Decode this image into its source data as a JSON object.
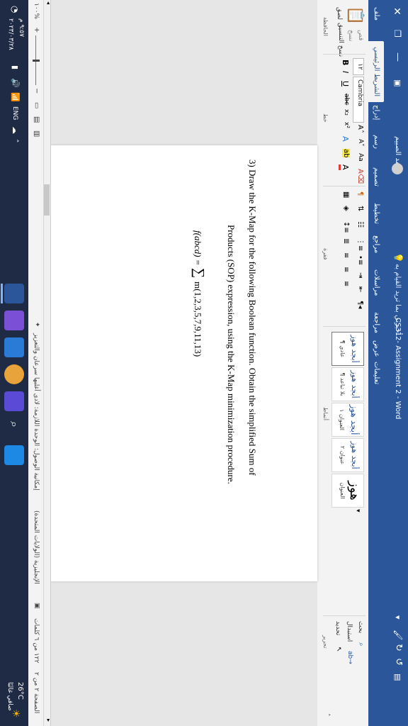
{
  "window": {
    "title": "CS312- Assignment 2  -  Word",
    "user_name": "محمد الصبيم",
    "search_placeholder": "أخبرني بما تريد القيام به"
  },
  "tabs": [
    "ملف",
    "الشريط الرئيسي",
    "إدراج",
    "رسم",
    "تصميم",
    "تخطيط",
    "مراجع",
    "مراسلات",
    "مراجعة",
    "عرض",
    "تعليمات"
  ],
  "ribbon": {
    "font_name": "Cambria",
    "font_size": "١٢",
    "groups": {
      "clipboard": "الحافظة",
      "font": "خط",
      "paragraph": "فقرة",
      "styles": "أنماط",
      "editing": "تحرير"
    },
    "clipboard": {
      "paste": "لصق",
      "cut": "قص",
      "copy": "نسخ",
      "format_painter": "نسخ التنسيق"
    },
    "editing": {
      "find": "بحث",
      "replace": "استبدال",
      "select": "تحديد"
    },
    "styles": [
      {
        "sample": "أبجد هوز",
        "name": "¶ عادي"
      },
      {
        "sample": "أبجد هوز",
        "name": "¶ بلا تباعد"
      },
      {
        "sample": "أبجد هوز",
        "name": "العنوان ١"
      },
      {
        "sample": "أبجد هوز",
        "name": "عنوان ٢"
      },
      {
        "sample": "هوز",
        "name": "العنوان"
      }
    ]
  },
  "document": {
    "line1": "3)  Draw the K-Map for the following Boolean function. Obtain the simplified Sum of",
    "line2": "Products (SOP) expression, using the K-Map minimization procedure.",
    "formula_lhs": "f(abcd) = ",
    "formula_sum": "∑",
    "formula_rhs": "m(1,2,3,5,7,9,11,13)"
  },
  "status": {
    "page": "الصفحة ٢ من ٢",
    "words": "١٢٢ من ٦ كلمات",
    "language": "الإنجليزية (الولايات المتحدة)",
    "accessibility": "إمكانية الوصول: الوحدة اللازمة: لادى أغلبها سرعان والتعزيز",
    "zoom": "١٠٠%"
  },
  "taskbar": {
    "weather_temp": "26°C",
    "weather_desc": "صافي غالبًا",
    "lang": "ENG",
    "time": "٩:٥٧ م",
    "date": "٢٠٢٣/٠٣/٢٨"
  }
}
